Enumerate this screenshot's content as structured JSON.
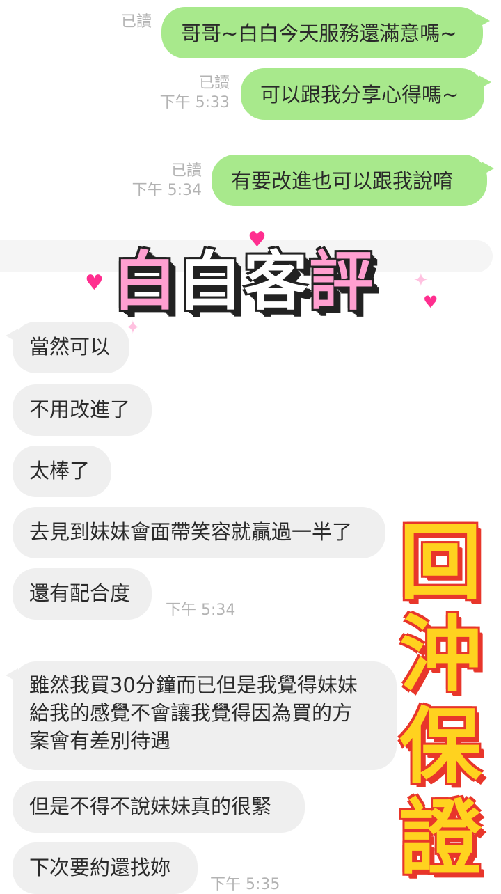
{
  "outgoing": [
    {
      "read": "已讀",
      "time": "",
      "text": "哥哥~白白今天服務還滿意嗎~"
    },
    {
      "read": "已讀",
      "time": "下午 5:33",
      "text": "可以跟我分享心得嗎~"
    },
    {
      "read": "已讀",
      "time": "下午 5:34",
      "text": "有要改進也可以跟我說唷"
    }
  ],
  "sticker": {
    "chars": [
      "白",
      "白",
      "客",
      "評"
    ]
  },
  "incoming": [
    {
      "text": "當然可以"
    },
    {
      "text": "不用改進了"
    },
    {
      "text": "太棒了"
    },
    {
      "text": "去見到妹妹會面帶笑容就贏過一半了"
    },
    {
      "text": "還有配合度",
      "time": "下午 5:34"
    },
    {
      "lines": [
        "雖然我買30分鐘而已但是我覺得妹妹",
        "給我的感覺不會讓我覺得因為買的方",
        "案會有差別待遇"
      ]
    },
    {
      "text": "但是不得不說妹妹真的很緊"
    },
    {
      "text": "下次要約還找妳",
      "time": "下午 5:35"
    }
  ],
  "stamp": {
    "chars": [
      "回",
      "沖",
      "保",
      "證"
    ]
  },
  "colors": {
    "outgoing_bubble": "#a8e98c",
    "incoming_bubble": "#efefef",
    "sticker_pink": "#ff9fd0",
    "stamp_yellow": "#ffd21f",
    "stamp_red": "#e8362b"
  },
  "icons": [
    "heart-icon",
    "sparkle-icon"
  ]
}
